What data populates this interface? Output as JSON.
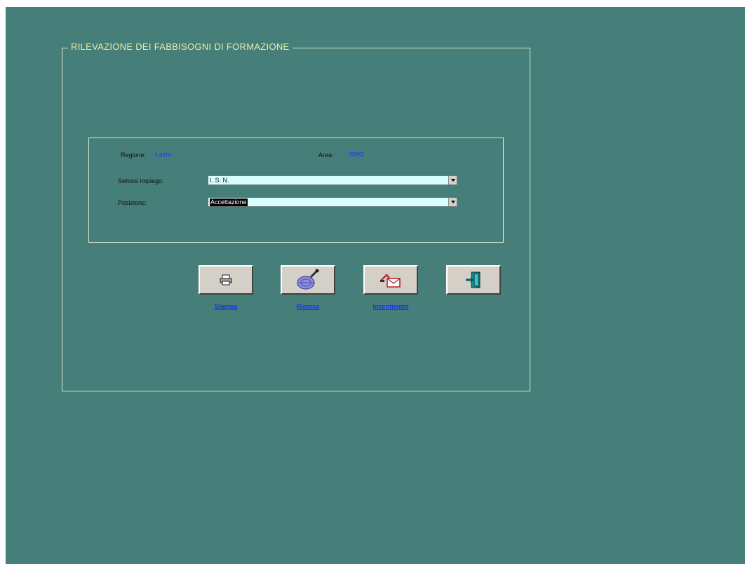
{
  "form": {
    "title": "RILEVAZIONE DEI FABBISOGNI DI FORMAZIONE"
  },
  "filters": {
    "regione_label": "Regione:",
    "regione_value": "Lazio",
    "area_label": "Area:",
    "area_value": "ORO",
    "settore_label": "Settore impiego:",
    "settore_value": "I. S. N.",
    "posizione_label": "Posizione:",
    "posizione_value": "Accettazione"
  },
  "buttons": {
    "print_label": "Stampa",
    "search_label": "Ricerca",
    "insert_label": "Inserimento",
    "exit_icon": "exit-door-icon"
  },
  "colors": {
    "background": "#467f7a",
    "border": "#d8e8c8",
    "title": "#e6eca8",
    "link_blue": "#1a2cff",
    "combo_bg": "#d8ffff"
  }
}
